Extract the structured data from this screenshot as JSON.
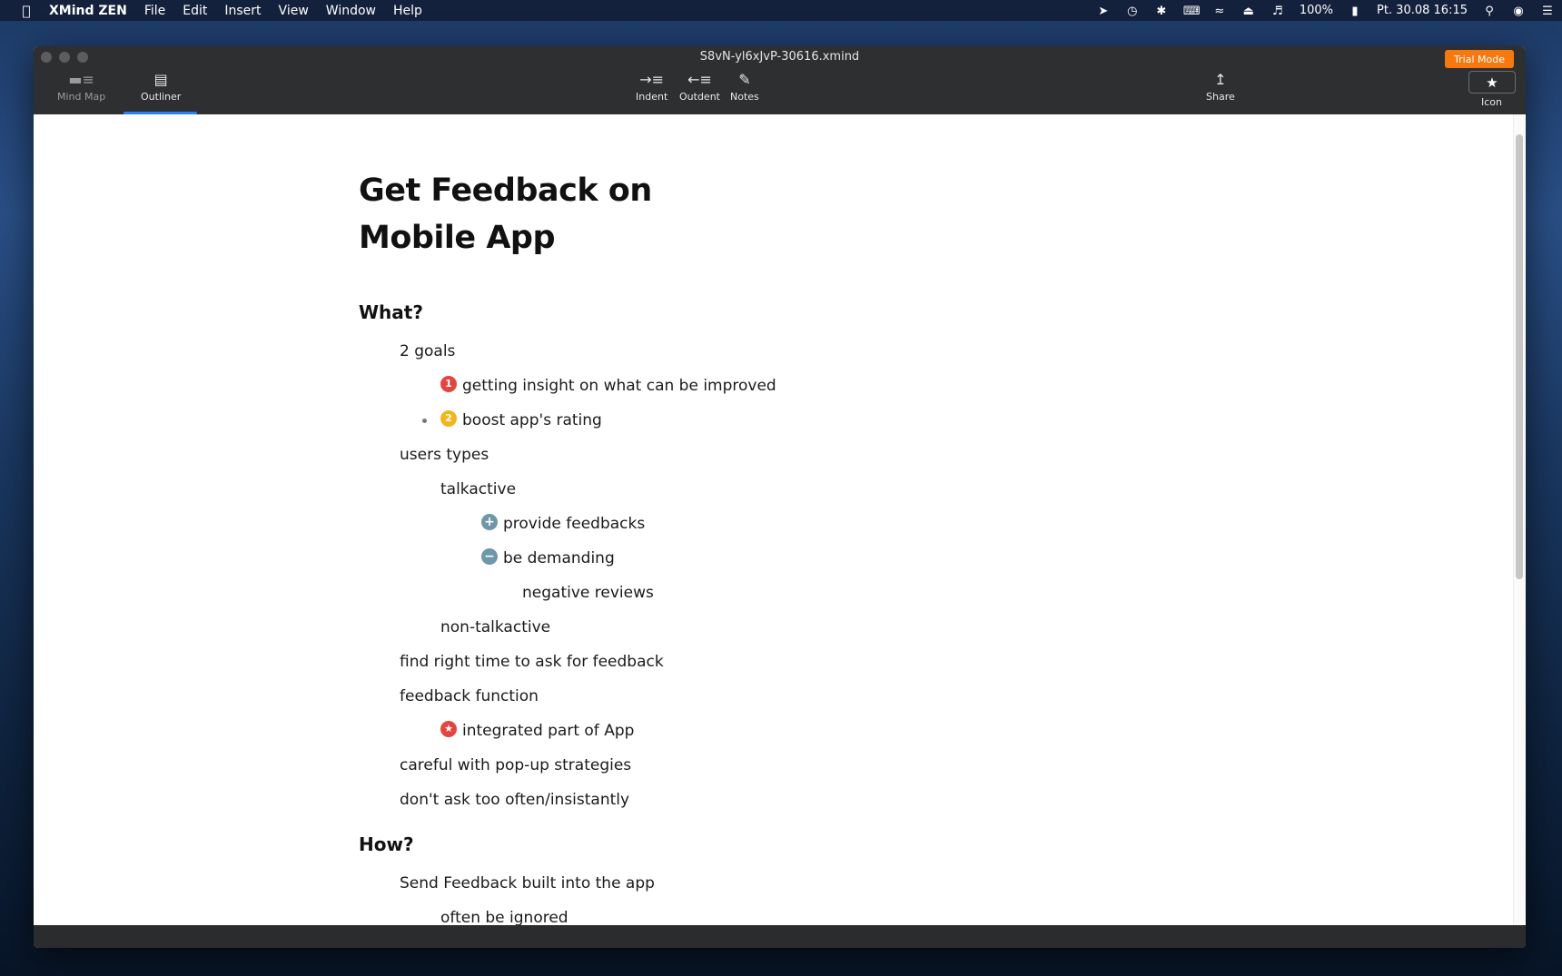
{
  "menubar": {
    "app_name": "XMind ZEN",
    "menus": [
      "File",
      "Edit",
      "Insert",
      "View",
      "Window",
      "Help"
    ],
    "battery": "100%",
    "datetime": "Pt. 30.08  16:15"
  },
  "window": {
    "title": "S8vN-yl6xJvP-30616.xmind",
    "trial_label": "Trial Mode"
  },
  "toolbar": {
    "mind_map": "Mind Map",
    "outliner": "Outliner",
    "indent": "Indent",
    "outdent": "Outdent",
    "notes": "Notes",
    "share": "Share",
    "icon": "Icon"
  },
  "outline": {
    "title": "Get Feedback on Mobile App",
    "what": {
      "heading": "What?",
      "goals": "2 goals",
      "goal1_badge": "1",
      "goal1": "getting insight on what can be improved",
      "goal2_badge": "2",
      "goal2": "boost app's rating",
      "users_types": "users types",
      "talkactive": "talkactive",
      "provide_feedbacks": "provide feedbacks",
      "be_demanding": "be demanding",
      "negative_reviews": "negative reviews",
      "non_talkactive": "non-talkactive",
      "find_right_time": "find right time to ask for feedback",
      "feedback_function": "feedback function",
      "integrated_part": "integrated part of App",
      "careful_popup": "careful with pop-up strategies",
      "dont_ask": "don't ask too often/insistantly"
    },
    "how": {
      "heading": "How?",
      "send_feedback": "Send Feedback built into the app",
      "often_ignored": "often be ignored"
    }
  },
  "colors": {
    "priority1": "#e5453f",
    "priority2": "#f2b51b",
    "symbol": "#6e97a9",
    "star": "#e5453f",
    "trial": "#f5790f",
    "accent": "#2c7ef8"
  }
}
